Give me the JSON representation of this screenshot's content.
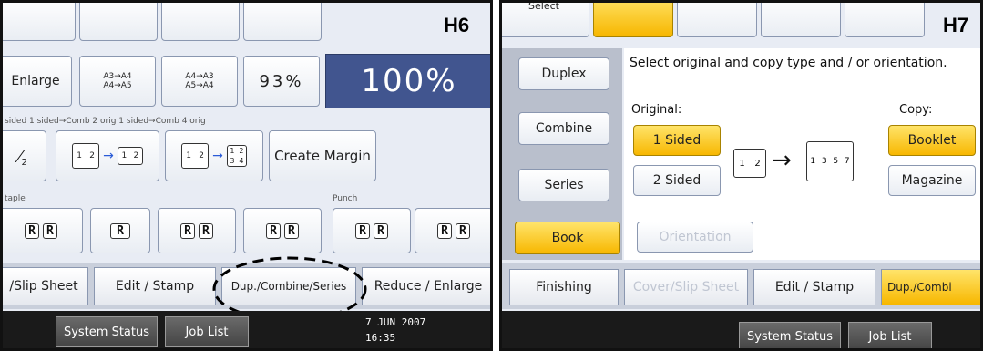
{
  "left": {
    "header": "H6",
    "reduce": {
      "enlarge_label": "Enlarge",
      "preset1": "A3→A4\nA4→A5",
      "preset2": "A4→A3\nA5→A4",
      "percent_label": "93%",
      "full_label": "100%"
    },
    "combine": {
      "row_label": "sided  1 sided→Comb 2 orig 1 sided→Comb 4 orig",
      "create_margin": "Create Margin",
      "num2": "2",
      "p1": "1",
      "p2": "2",
      "p3": "3",
      "p4": "4"
    },
    "staple_label": "taple",
    "punch_label": "Punch",
    "r_glyph": "R",
    "tabs": [
      {
        "label": "/Slip Sheet"
      },
      {
        "label": "Edit / Stamp"
      },
      {
        "label": "Dup./Combine/Series"
      },
      {
        "label": "Reduce / Enlarge"
      }
    ],
    "status": {
      "system_status": "System Status",
      "job_list": "Job List",
      "date": "7  JUN   2007",
      "time": "16:35"
    }
  },
  "right": {
    "header": "H7",
    "top_label": "Select",
    "instruction": "Select original and copy type and / or orientation.",
    "sidebar": [
      {
        "label": "Duplex"
      },
      {
        "label": "Combine"
      },
      {
        "label": "Series"
      },
      {
        "label": "Book"
      }
    ],
    "original_label": "Original:",
    "copy_label": "Copy:",
    "original_options": [
      {
        "label": "1 Sided"
      },
      {
        "label": "2 Sided"
      }
    ],
    "copy_options": [
      {
        "label": "Booklet"
      },
      {
        "label": "Magazine"
      }
    ],
    "orientation_label": "Orientation",
    "booklet_pages": [
      "1",
      "3",
      "5",
      "7"
    ],
    "tabs": [
      {
        "label": "Finishing"
      },
      {
        "label": "Cover/Slip Sheet"
      },
      {
        "label": "Edit / Stamp"
      },
      {
        "label": "Dup./Combi"
      }
    ],
    "status": {
      "system_status": "System Status",
      "job_list": "Job List"
    }
  }
}
